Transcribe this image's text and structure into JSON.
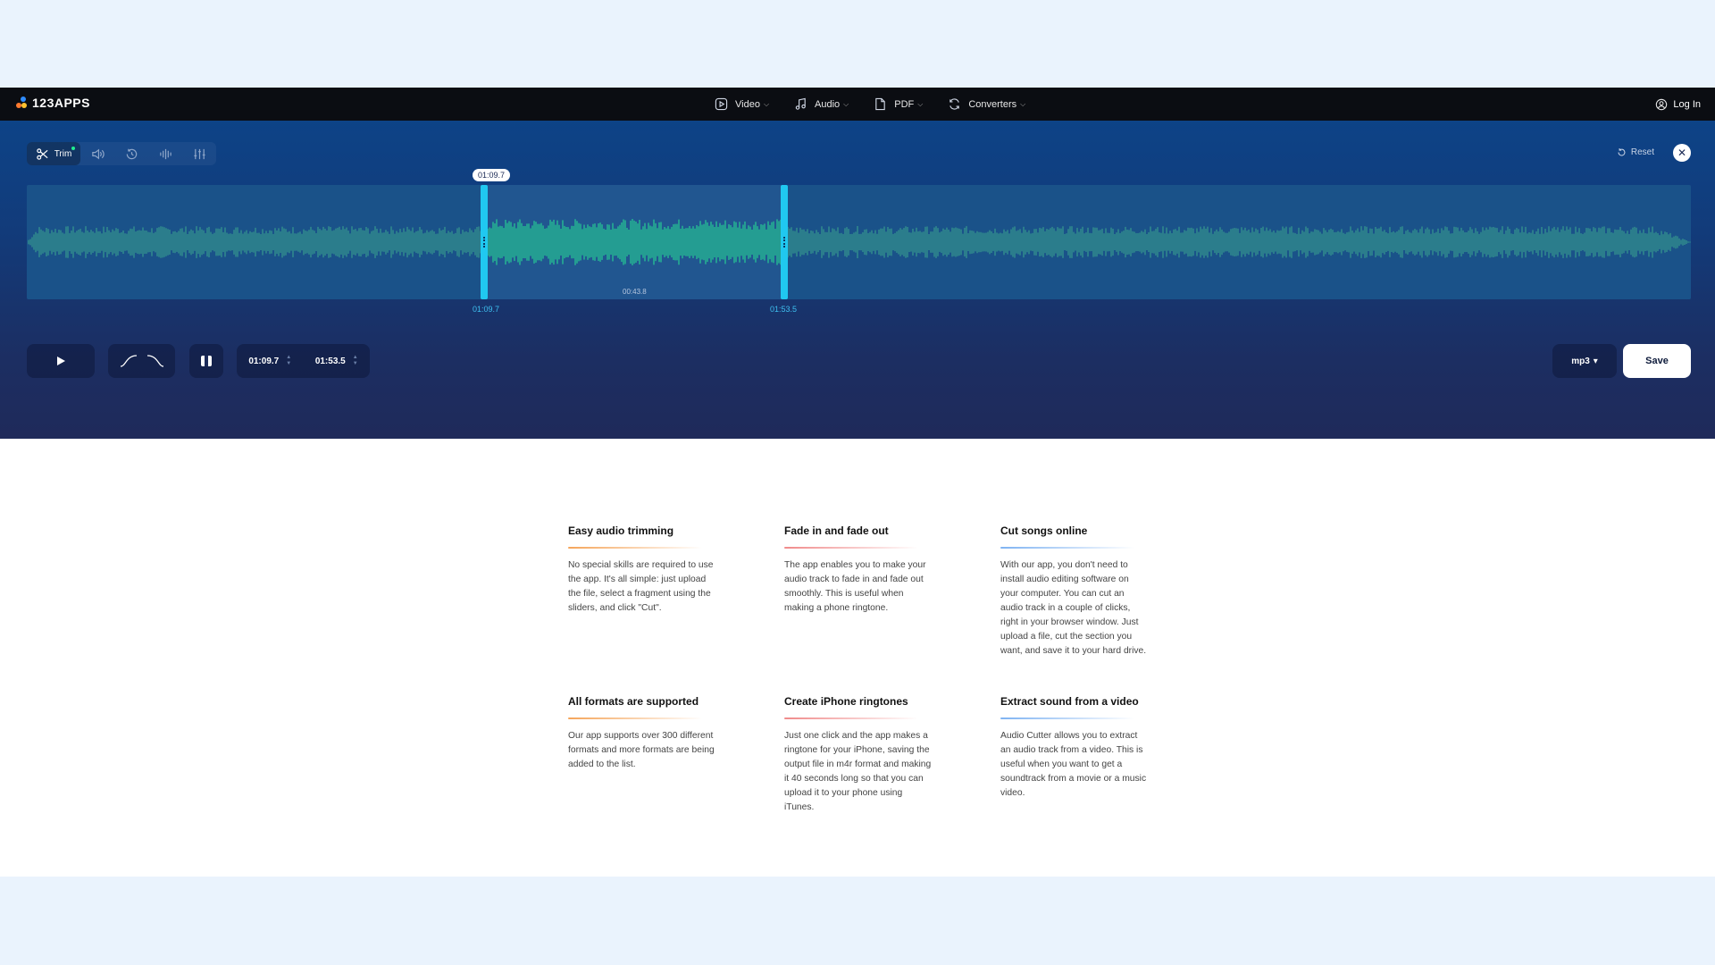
{
  "header": {
    "logo_text": "123APPS",
    "nav": [
      {
        "label": "Video",
        "icon": "video-icon"
      },
      {
        "label": "Audio",
        "icon": "music-note-icon"
      },
      {
        "label": "PDF",
        "icon": "document-icon"
      },
      {
        "label": "Converters",
        "icon": "converter-icon"
      }
    ],
    "login_label": "Log In"
  },
  "toolbar": {
    "trim_label": "Trim",
    "tools": [
      "scissors-icon",
      "volume-icon",
      "speed-icon",
      "equalizer-icon",
      "sliders-icon"
    ],
    "reset_label": "Reset",
    "close_icon": "close-icon"
  },
  "waveform": {
    "selection_start_tooltip": "01:09.7",
    "selection_duration": "00:43.8",
    "start_marker": "01:09.7",
    "end_marker": "01:53.5",
    "selected_color": "#1ff08f",
    "unselected_color": "#2b7d8c"
  },
  "controls": {
    "start_time": "01:09.7",
    "end_time": "01:53.5",
    "format": "mp3",
    "format_arrow": "▾",
    "save_label": "Save"
  },
  "features": [
    {
      "title": "Easy audio trimming",
      "text": "No special skills are required to use the app. It's all simple: just upload the file, select a fragment using the sliders, and click \"Cut\".",
      "accent": "#f5a55a"
    },
    {
      "title": "Fade in and fade out",
      "text": "The app enables you to make your audio track to fade in and fade out smoothly. This is useful when making a phone ringtone.",
      "accent": "#f08a8a"
    },
    {
      "title": "Cut songs online",
      "text": "With our app, you don't need to install audio editing software on your computer. You can cut an audio track in a couple of clicks, right in your browser window. Just upload a file, cut the section you want, and save it to your hard drive.",
      "accent": "#7fb3f2"
    },
    {
      "title": "All formats are supported",
      "text": "Our app supports over 300 different formats and more formats are being added to the list.",
      "accent": "#f5a55a"
    },
    {
      "title": "Create iPhone ringtones",
      "text": "Just one click and the app makes a ringtone for your iPhone, saving the output file in m4r format and making it 40 seconds long so that you can upload it to your phone using iTunes.",
      "accent": "#f08a8a"
    },
    {
      "title": "Extract sound from a video",
      "text": "Audio Cutter allows you to extract an audio track from a video. This is useful when you want to get a soundtrack from a movie or a music video.",
      "accent": "#7fb3f2"
    }
  ]
}
